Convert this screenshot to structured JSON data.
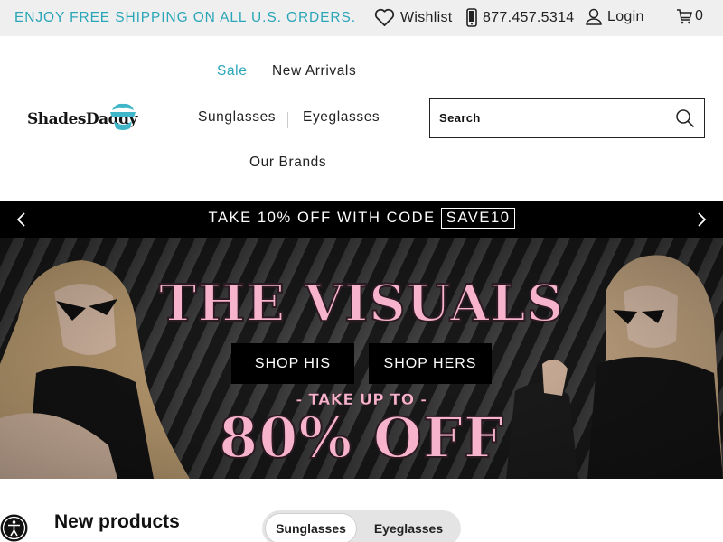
{
  "topbar": {
    "promo": "ENJOY FREE SHIPPING ON ALL U.S. ORDERS.",
    "wishlist": "Wishlist",
    "phone": "877.457.5314",
    "login": "Login",
    "cart_count": "0",
    "icons": [
      "heart-icon",
      "phone-icon",
      "user-icon",
      "cart-icon"
    ]
  },
  "header": {
    "logo": "ShadesDaddy",
    "nav": [
      "Sale",
      "New Arrivals",
      "Sunglasses",
      "Eyeglasses",
      "Our Brands"
    ],
    "search_label": "Search"
  },
  "announcement": {
    "text": "TAKE 10% OFF WITH CODE",
    "code": "SAVE10"
  },
  "hero": {
    "title": "THE VISUALS",
    "buttons": [
      "SHOP HIS",
      "SHOP HERS"
    ],
    "subtitle": "- TAKE UP TO -",
    "offer": "80% OFF"
  },
  "section": {
    "heading": "New products",
    "tabs": [
      "Sunglasses",
      "Eyeglasses"
    ],
    "active_tab": "Sunglasses"
  },
  "colors": {
    "accent": "#2aa6b8",
    "hero_pink": "#f7b3cc",
    "topbar_bg": "#efefef"
  }
}
